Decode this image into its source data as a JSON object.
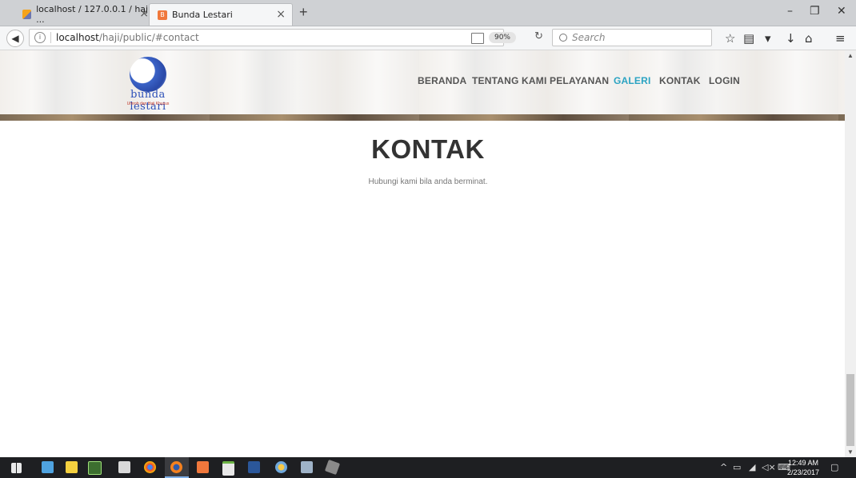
{
  "browser": {
    "tabs": [
      {
        "title": "localhost / 127.0.0.1 / haji ...",
        "active": false
      },
      {
        "title": "Bunda Lestari",
        "active": true
      }
    ],
    "url_host": "localhost",
    "url_path": "/haji/public/#contact",
    "zoom": "90%",
    "search_placeholder": "Search"
  },
  "site": {
    "logo_text": "bunda lestari",
    "logo_tagline": "Umroh dan Haji Khusus",
    "nav": [
      {
        "label": "BERANDA",
        "active": false
      },
      {
        "label": "TENTANG KAMI",
        "active": false
      },
      {
        "label": "PELAYANAN",
        "active": false
      },
      {
        "label": "GALERI",
        "active": true
      },
      {
        "label": "KONTAK",
        "active": false
      },
      {
        "label": "LOGIN",
        "active": false
      }
    ],
    "section_title": "KONTAK",
    "section_subtitle": "Hubungi kami bila anda berminat."
  },
  "taskbar": {
    "time": "12:49 AM",
    "date": "2/23/2017"
  },
  "colors": {
    "nav_active": "#2aa3c2",
    "nav_text": "#555555",
    "heading": "#333333",
    "logo": "#2b4fb8"
  }
}
